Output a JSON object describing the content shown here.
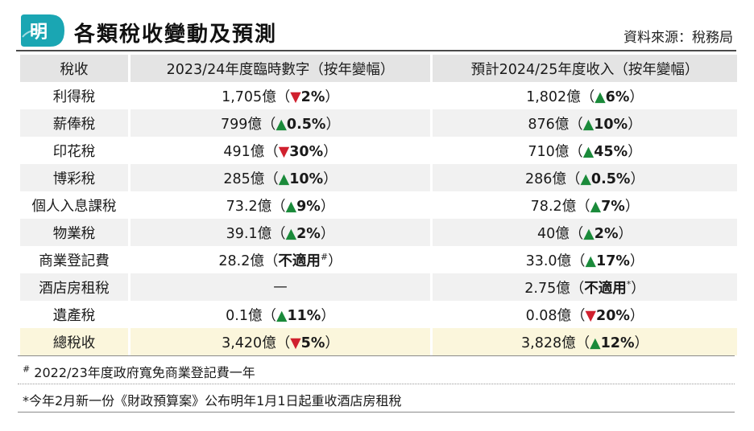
{
  "header": {
    "logo_char": "明",
    "title": "各類稅收變動及預測",
    "source": "資料來源：稅務局"
  },
  "colors": {
    "logo_teal": "#1aa6b3",
    "up": "#1a8a3a",
    "down": "#d0202e",
    "header_row": "#e4e4e4",
    "stripe": "#f1f1f1",
    "total_row": "#fbf6dc"
  },
  "table": {
    "headers": [
      "稅收",
      "2023/24年度臨時數字（按年變幅）",
      "預計2024/25年度收入（按年變幅）"
    ],
    "rows": [
      {
        "name": "利得稅",
        "a_val": "1,705億（",
        "a_arrow": "▼",
        "a_dir": "down",
        "a_chg": "2%",
        "a_end": "）",
        "b_val": "1,802億（",
        "b_arrow": "▲",
        "b_dir": "up",
        "b_chg": "6%",
        "b_end": "）"
      },
      {
        "name": "薪俸稅",
        "a_val": "799億（",
        "a_arrow": "▲",
        "a_dir": "up",
        "a_chg": "0.5%",
        "a_end": "）",
        "b_val": "876億（",
        "b_arrow": "▲",
        "b_dir": "up",
        "b_chg": "10%",
        "b_end": "）"
      },
      {
        "name": "印花稅",
        "a_val": "491億（",
        "a_arrow": "▼",
        "a_dir": "down",
        "a_chg": "30%",
        "a_end": "）",
        "b_val": "710億（",
        "b_arrow": "▲",
        "b_dir": "up",
        "b_chg": "45%",
        "b_end": "）"
      },
      {
        "name": "博彩稅",
        "a_val": "285億（",
        "a_arrow": "▲",
        "a_dir": "up",
        "a_chg": "10%",
        "a_end": "）",
        "b_val": "286億（",
        "b_arrow": "▲",
        "b_dir": "up",
        "b_chg": "0.5%",
        "b_end": "）"
      },
      {
        "name": "個人入息課稅",
        "a_val": "73.2億（",
        "a_arrow": "▲",
        "a_dir": "up",
        "a_chg": "9%",
        "a_end": "）",
        "b_val": "78.2億（",
        "b_arrow": "▲",
        "b_dir": "up",
        "b_chg": "7%",
        "b_end": "）"
      },
      {
        "name": "物業稅",
        "a_val": "39.1億（",
        "a_arrow": "▲",
        "a_dir": "up",
        "a_chg": "2%",
        "a_end": "）",
        "b_val": "40億（",
        "b_arrow": "▲",
        "b_dir": "up",
        "b_chg": "2%",
        "b_end": "）"
      },
      {
        "name": "商業登記費",
        "a_val": "28.2億（",
        "a_arrow": "",
        "a_dir": "na",
        "a_chg": "不適用",
        "a_sup": "#",
        "a_end": "）",
        "b_val": "33.0億（",
        "b_arrow": "▲",
        "b_dir": "up",
        "b_chg": "17%",
        "b_end": "）"
      },
      {
        "name": "酒店房租稅",
        "a_val": "—",
        "a_arrow": "",
        "a_dir": "none",
        "a_chg": "",
        "a_end": "",
        "b_val": "2.75億（",
        "b_arrow": "",
        "b_dir": "na",
        "b_chg": "不適用",
        "b_sup": "*",
        "b_end": "）"
      },
      {
        "name": "遺產稅",
        "a_val": "0.1億（",
        "a_arrow": "▲",
        "a_dir": "up",
        "a_chg": "11%",
        "a_end": "）",
        "b_val": "0.08億（",
        "b_arrow": "▼",
        "b_dir": "down",
        "b_chg": "20%",
        "b_end": "）"
      },
      {
        "name": "總稅收",
        "a_val": "3,420億（",
        "a_arrow": "▼",
        "a_dir": "down",
        "a_chg": "5%",
        "a_end": "）",
        "b_val": "3,828億（",
        "b_arrow": "▲",
        "b_dir": "up",
        "b_chg": "12%",
        "b_end": "）",
        "total": true
      }
    ]
  },
  "notes": {
    "note1_mark": "#",
    "note1": " 2022/23年度政府寬免商業登記費一年",
    "note2": "*今年2月新一份《財政預算案》公布明年1月1日起重收酒店房租稅"
  }
}
